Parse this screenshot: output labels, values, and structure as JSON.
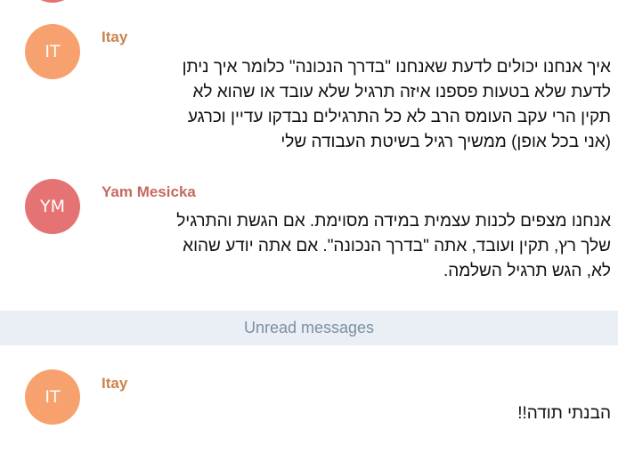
{
  "colors": {
    "itay_avatar": "#f7a26e",
    "yam_avatar": "#e57373",
    "itay_name": "#c9844d",
    "yam_name": "#c46a60",
    "divider_bg": "#e9eff4",
    "divider_text": "#7d8fa0"
  },
  "messages": [
    {
      "initials": "IT",
      "author": "Itay",
      "text": "איך אנחנו יכולים לדעת שאנחנו \"בדרך הנכונה\" כלומר איך ניתן\nלדעת שלא בטעות פספנו איזה תרגיל שלא עובד או שהוא לא\nתקין הרי עקב העומס הרב לא כל התרגילים נבדקו עדיין וכרגע\n(אני בכל אופן) ממשיך רגיל בשיטת העבודה שלי"
    },
    {
      "initials": "YM",
      "author": "Yam Mesicka",
      "text": "אנחנו מצפים לכנות עצמית במידה מסוימת. אם הגשת והתרגיל\nשלך רץ, תקין ועובד, אתה \"בדרך הנכונה\". אם אתה יודע שהוא\nלא, הגש תרגיל השלמה."
    },
    {
      "initials": "IT",
      "author": "Itay",
      "text": "הבנתי תודה!!"
    }
  ],
  "divider": {
    "label": "Unread messages"
  }
}
